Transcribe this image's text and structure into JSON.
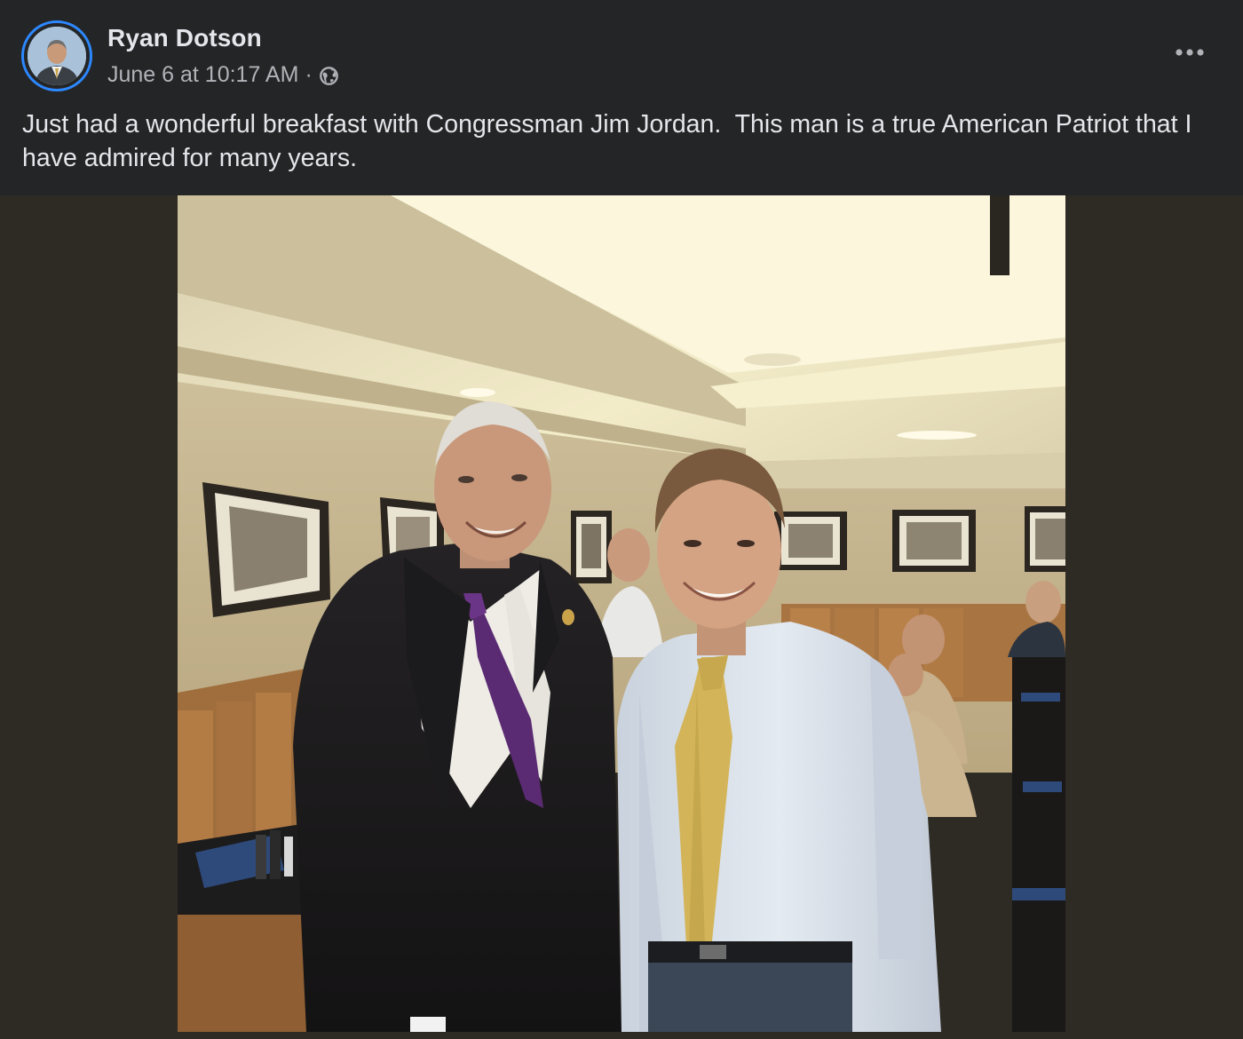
{
  "post": {
    "author_name": "Ryan Dotson",
    "timestamp": "June 6 at 10:17 AM",
    "separator": "·",
    "privacy_icon": "globe-icon",
    "more_icon": "more-horizontal-icon",
    "text": "Just had a wonderful breakfast with Congressman Jim Jordan.  This man is a true American Patriot that I have admired for many years."
  },
  "colors": {
    "background": "#242526",
    "primary_text": "#e4e6eb",
    "secondary_text": "#b0b3b8",
    "avatar_ring": "#2d88ff",
    "media_backdrop": "#2e2a24"
  }
}
